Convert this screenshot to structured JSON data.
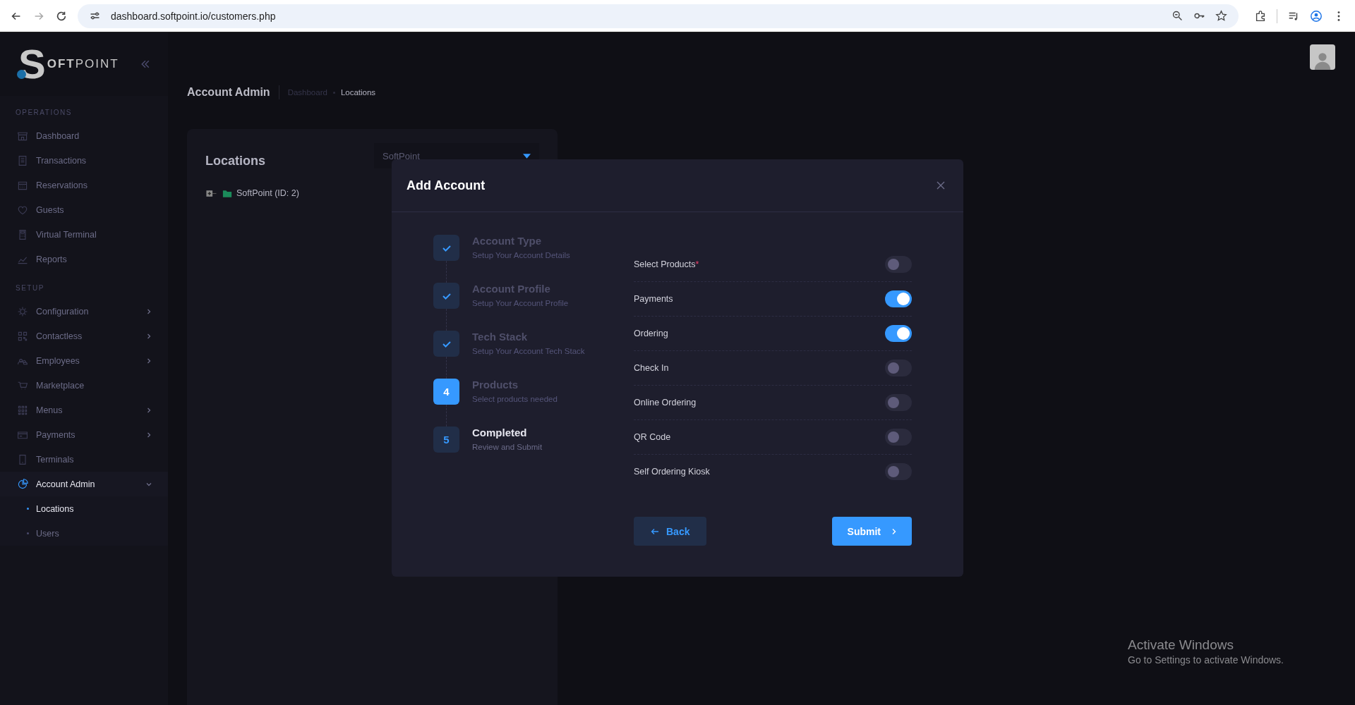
{
  "browser": {
    "url": "dashboard.softpoint.io/customers.php"
  },
  "logo": {
    "initial": "S",
    "bold": "OFT",
    "light": "POINT"
  },
  "sidebar": {
    "sections": [
      {
        "title": "OPERATIONS",
        "items": [
          {
            "label": "Dashboard",
            "kind": "link",
            "selected": false
          },
          {
            "label": "Transactions",
            "kind": "link",
            "selected": false
          },
          {
            "label": "Reservations",
            "kind": "link",
            "selected": false
          },
          {
            "label": "Guests",
            "kind": "link",
            "selected": false
          },
          {
            "label": "Virtual Terminal",
            "kind": "link",
            "selected": false
          },
          {
            "label": "Reports",
            "kind": "link",
            "selected": false
          }
        ]
      },
      {
        "title": "SETUP",
        "items": [
          {
            "label": "Configuration",
            "kind": "group",
            "expanded": false,
            "selected": false
          },
          {
            "label": "Contactless",
            "kind": "group",
            "expanded": false,
            "selected": false
          },
          {
            "label": "Employees",
            "kind": "group",
            "expanded": false,
            "selected": false
          },
          {
            "label": "Marketplace",
            "kind": "link",
            "selected": false
          },
          {
            "label": "Menus",
            "kind": "group",
            "expanded": false,
            "selected": false
          },
          {
            "label": "Payments",
            "kind": "group",
            "expanded": false,
            "selected": false
          },
          {
            "label": "Terminals",
            "kind": "link",
            "selected": false
          },
          {
            "label": "Account Admin",
            "kind": "group",
            "expanded": true,
            "selected": true,
            "children": [
              {
                "label": "Locations",
                "selected": true
              },
              {
                "label": "Users",
                "selected": false
              }
            ]
          }
        ]
      }
    ]
  },
  "page_header": {
    "title": "Account Admin",
    "breadcrumb": [
      {
        "label": "Dashboard",
        "selected": false
      },
      {
        "label": "Locations",
        "selected": true
      }
    ]
  },
  "locations_card": {
    "title": "Locations",
    "dropdown_value": "SoftPoint",
    "tree": [
      {
        "label": "SoftPoint (ID: 2)",
        "expanded": false
      }
    ]
  },
  "modal": {
    "title": "Add Account",
    "steps": [
      {
        "title": "Account Type",
        "subtitle": "Setup Your Account Details",
        "kind": "done"
      },
      {
        "title": "Account Profile",
        "subtitle": "Setup Your Account Profile",
        "kind": "done"
      },
      {
        "title": "Tech Stack",
        "subtitle": "Setup Your Account Tech Stack",
        "kind": "done"
      },
      {
        "number": "4",
        "title": "Products",
        "subtitle": "Select products needed",
        "kind": "current"
      },
      {
        "number": "5",
        "title": "Completed",
        "subtitle": "Review and Submit",
        "kind": "pending"
      }
    ],
    "products": [
      {
        "label": "Select Products",
        "required_mark": "*",
        "on": false
      },
      {
        "label": "Payments",
        "on": true
      },
      {
        "label": "Ordering",
        "on": true
      },
      {
        "label": "Check In",
        "on": false
      },
      {
        "label": "Online Ordering",
        "on": false
      },
      {
        "label": "QR Code",
        "on": false
      },
      {
        "label": "Self Ordering Kiosk",
        "on": false
      }
    ],
    "back_button": "Back",
    "submit_button": "Submit"
  },
  "os_notice": {
    "title": "Activate Windows",
    "text": "Go to Settings to activate Windows."
  }
}
